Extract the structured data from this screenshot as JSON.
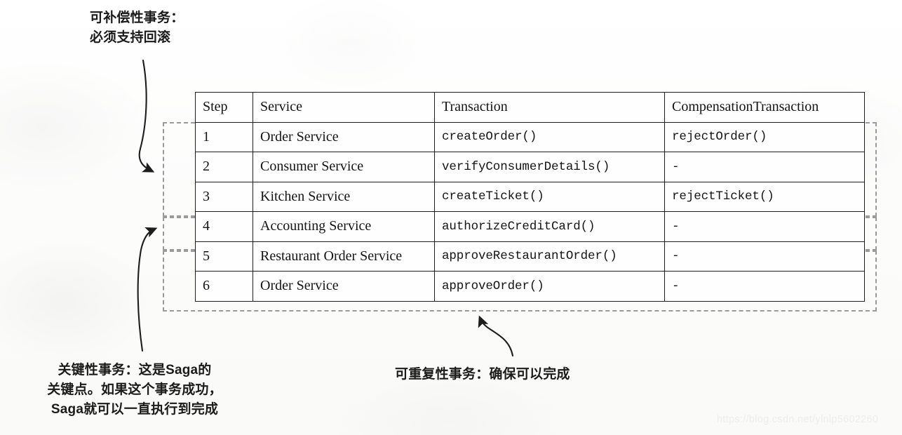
{
  "table": {
    "headers": [
      "Step",
      "Service",
      "Transaction",
      "CompensationTransaction"
    ],
    "rows": [
      {
        "step": "1",
        "service": "Order Service",
        "transaction": "createOrder()",
        "compensation": "rejectOrder()"
      },
      {
        "step": "2",
        "service": "Consumer Service",
        "transaction": "verifyConsumerDetails()",
        "compensation": "-"
      },
      {
        "step": "3",
        "service": "Kitchen Service",
        "transaction": "createTicket()",
        "compensation": "rejectTicket()"
      },
      {
        "step": "4",
        "service": "Accounting Service",
        "transaction": "authorizeCreditCard()",
        "compensation": "-"
      },
      {
        "step": "5",
        "service": "Restaurant Order Service",
        "transaction": "approveRestaurantOrder()",
        "compensation": "-"
      },
      {
        "step": "6",
        "service": "Order Service",
        "transaction": "approveOrder()",
        "compensation": "-"
      }
    ]
  },
  "annotations": {
    "compensatable": "可补偿性事务：\n必须支持回滚",
    "pivot": "关键性事务：这是Saga的\n关键点。如果这个事务成功，\nSaga就可以一直执行到完成",
    "retriable": "可重复性事务：确保可以完成"
  },
  "watermark": "https://blog.csdn.net/ylnlp5602260",
  "colors": {
    "ink": "#1d1d1d",
    "dashed_group": "#9a9a9a",
    "paper": "#fdfdfc",
    "watermark": "#eceded"
  }
}
